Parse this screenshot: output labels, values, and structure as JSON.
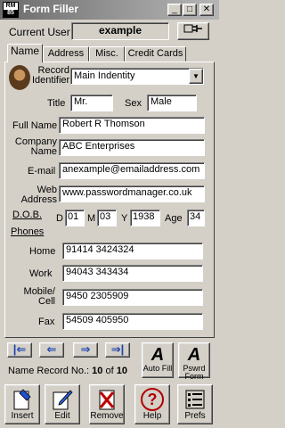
{
  "window": {
    "title": "Form Filler",
    "logo_top": "RM",
    "logo_bottom": "85",
    "min": "_",
    "max": "□",
    "close": "✕"
  },
  "current_user": {
    "label": "Current User",
    "value": "example"
  },
  "tabs": [
    "Name",
    "Address",
    "Misc.",
    "Credit Cards"
  ],
  "record": {
    "label": "Record Identifier",
    "value": "Main Indentity"
  },
  "title": {
    "label": "Title",
    "value": "Mr."
  },
  "sex": {
    "label": "Sex",
    "value": "Male"
  },
  "full_name": {
    "label": "Full Name",
    "value": "Robert R Thomson"
  },
  "company": {
    "label": "Company Name",
    "value": "ABC Enterprises"
  },
  "email": {
    "label": "E-mail",
    "value": "anexample@emailaddress.com"
  },
  "web": {
    "label": "Web Address",
    "value": "www.passwordmanager.co.uk"
  },
  "dob": {
    "label": "D.O.B.",
    "d_label": "D",
    "d": "01",
    "m_label": "M",
    "m": "03",
    "y_label": "Y",
    "y": "1938",
    "age_label": "Age",
    "age": "34"
  },
  "phones": {
    "header": "Phones",
    "home": {
      "label": "Home",
      "value": "91414 3424324"
    },
    "work": {
      "label": "Work",
      "value": "94043 343434"
    },
    "mobile": {
      "label": "Mobile/ Cell",
      "value": "9450 2305909"
    },
    "fax": {
      "label": "Fax",
      "value": "54509 405950"
    }
  },
  "nav": {
    "first": "|⇐",
    "prev": "⇐",
    "next": "⇒",
    "last": "⇒|",
    "record_label": "Name Record No.:",
    "current": "10",
    "of": "of",
    "total": "10"
  },
  "autofill": {
    "glyph": "A",
    "label": "Auto Fill"
  },
  "pswrd": {
    "glyph": "A",
    "label": "Pswrd Form"
  },
  "toolbar": {
    "insert": "Insert",
    "edit": "Edit",
    "remove": "Remove",
    "help": "Help",
    "help_glyph": "?",
    "prefs": "Prefs"
  }
}
